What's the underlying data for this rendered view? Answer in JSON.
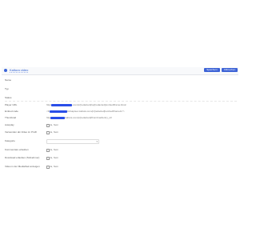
{
  "header": {
    "title": "Kaltura video",
    "buttons": [
      {
        "label": "Speichern"
      },
      {
        "label": "Abbrechen"
      }
    ]
  },
  "rows": [
    {
      "label": "Name"
    },
    {
      "label": "Typ"
    },
    {
      "label": "Status"
    },
    {
      "label": "Player URL",
      "value": "https://cdnapisec.kaltura.com/p/[redacted]/sp/[redacted]/embedIframeJs/uiconf_id/"
    },
    {
      "label": "Embed code",
      "value": "<iframe src=\"https://cdnapisec.kaltura.com/p/[redacted]/embedIframeJs\">"
    },
    {
      "label": "Thumbnail",
      "value": "https://cdnapisec.kaltura.com/p/[redacted]/thumbnail/entry_id/"
    },
    {
      "label": "Autoplay",
      "checkbox": "Ja, Nein"
    },
    {
      "label": "Verwenden als Video im Profil",
      "checkbox": "Ja, Nein"
    },
    {
      "label": "Kategorie",
      "select": ""
    },
    {
      "label": "Kommentare erlauben",
      "checkbox": "Ja, Nein"
    },
    {
      "label": "Download erlauben (Teilnehmer)",
      "checkbox": "Ja, Nein"
    },
    {
      "label": "Video in der Mediathek anzeigen",
      "checkbox": "Ja, Nein"
    }
  ],
  "colors": {
    "accent": "#3d63d6",
    "redaction": "#2a4ee8"
  },
  "icons": [
    "video-icon",
    "chevron-down-icon"
  ]
}
